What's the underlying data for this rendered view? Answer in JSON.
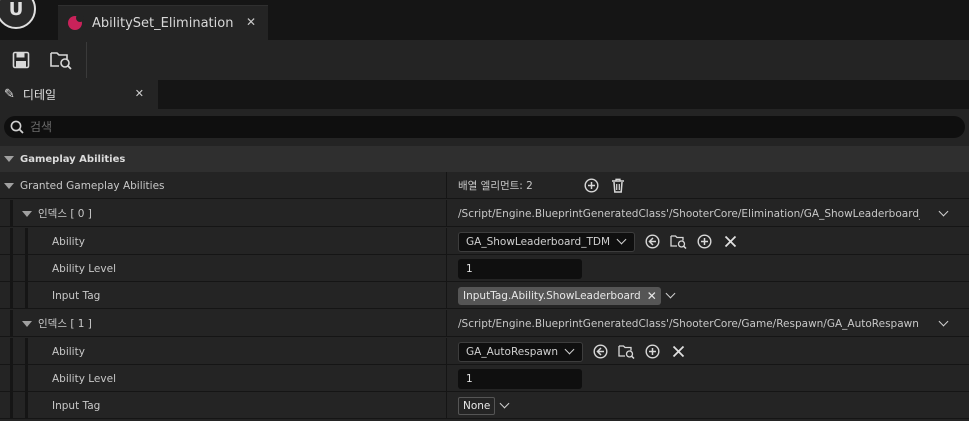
{
  "window": {
    "asset_tab_title": "AbilitySet_Elimination",
    "close_glyph": "✕"
  },
  "details": {
    "tab_label": "디테일",
    "search_placeholder": "검색"
  },
  "category": {
    "label": "Gameplay Abilities"
  },
  "granted": {
    "label": "Granted Gameplay Abilities",
    "array_text": "배열 엘리먼트: 2"
  },
  "elements": [
    {
      "index_label": "인덱스 [ 0 ]",
      "path": "/Script/Engine.BlueprintGeneratedClass'/ShooterCore/Elimination/GA_ShowLeaderboard_TDM.GA_ShowLeaderboard_TDM_C'",
      "ability_label": "Ability",
      "ability_value": "GA_ShowLeaderboard_TDM",
      "level_label": "Ability Level",
      "level_value": "1",
      "tag_label": "Input Tag",
      "tag_value": "InputTag.Ability.ShowLeaderboard"
    },
    {
      "index_label": "인덱스 [ 1 ]",
      "path": "/Script/Engine.BlueprintGeneratedClass'/ShooterCore/Game/Respawn/GA_AutoRespawn.GA_AutoRespawn_C'",
      "ability_label": "Ability",
      "ability_value": "GA_AutoRespawn",
      "level_label": "Ability Level",
      "level_value": "1",
      "tag_label": "Input Tag",
      "tag_value": "None"
    }
  ],
  "colors": {
    "accent": "#c9225a",
    "panel_bg": "#242424",
    "field_bg": "#0f0f0f"
  }
}
